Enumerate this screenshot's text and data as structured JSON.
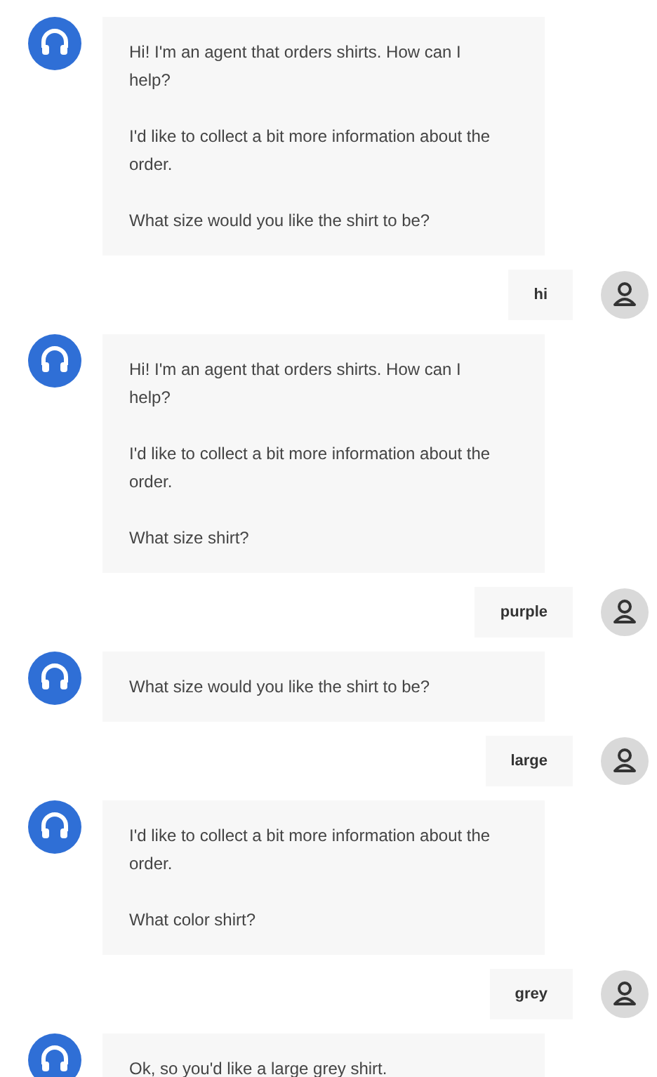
{
  "messages": [
    {
      "kind": "bot",
      "paragraphs": [
        "Hi! I'm an agent that orders shirts. How can I help?",
        "I'd like to collect a bit more information about the order.",
        "What size would you like the shirt to be?"
      ]
    },
    {
      "kind": "user",
      "paragraphs": [
        "hi"
      ]
    },
    {
      "kind": "bot",
      "paragraphs": [
        "Hi! I'm an agent that orders shirts. How can I help?",
        "I'd like to collect a bit more information about the order.",
        "What size shirt?"
      ]
    },
    {
      "kind": "user",
      "paragraphs": [
        "purple"
      ]
    },
    {
      "kind": "bot",
      "paragraphs": [
        "What size would you like the shirt to be?"
      ]
    },
    {
      "kind": "user",
      "paragraphs": [
        "large"
      ]
    },
    {
      "kind": "bot",
      "paragraphs": [
        "I'd like to collect a bit more information about the order.",
        "What color shirt?"
      ]
    },
    {
      "kind": "user",
      "paragraphs": [
        "grey"
      ]
    },
    {
      "kind": "bot",
      "paragraphs": [
        "Ok, so you'd like a large grey shirt."
      ]
    }
  ]
}
